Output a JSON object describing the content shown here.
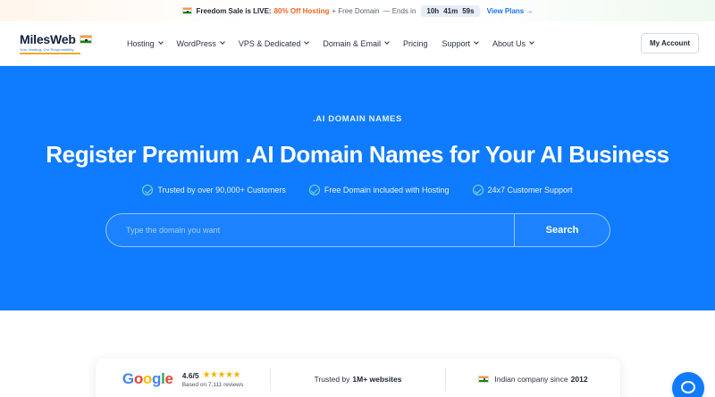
{
  "promo": {
    "lead": "Freedom Sale is LIVE:",
    "offer": "80% Off Hosting",
    "extra": "+ Free Domain",
    "ends_label": "— Ends in",
    "timer": {
      "hours": "10h",
      "minutes": "41m",
      "seconds": "59s"
    },
    "cta": "View Plans →"
  },
  "nav": {
    "logo": "MilesWeb",
    "tagline": "Your Hosting, Our Responsibility",
    "menu": [
      {
        "label": "Hosting"
      },
      {
        "label": "WordPress"
      },
      {
        "label": "VPS & Dedicated"
      },
      {
        "label": "Domain & Email"
      },
      {
        "label": "Pricing"
      },
      {
        "label": "Support"
      },
      {
        "label": "About Us"
      }
    ],
    "account": "My Account"
  },
  "hero": {
    "eyebrow": ".AI DOMAIN NAMES",
    "title": "Register Premium .AI Domain Names for Your AI Business",
    "features": [
      "Trusted by over 90,000+ Customers",
      "Free Domain included with Hosting",
      "24x7 Customer Support"
    ],
    "search": {
      "placeholder": "Type the domain you want",
      "button": "Search"
    }
  },
  "trust": {
    "google": {
      "g1": "G",
      "g2": "o",
      "g3": "o",
      "g4": "g",
      "g5": "l",
      "g6": "e"
    },
    "rating": "4.6/5",
    "stars": "★★★★★",
    "reviews": "Based on 7,111 reviews",
    "websites_prefix": "Trusted by",
    "websites_value": "1M+ websites",
    "company_prefix": "Indian company since",
    "company_year": "2012"
  },
  "colors": {
    "brand_blue": "#0f7bff",
    "accent_orange": "#f26522",
    "star": "#f4b400"
  },
  "icons": [
    "india-flag-icon",
    "chevron-down-icon",
    "check-circle-icon",
    "chat-icon"
  ]
}
